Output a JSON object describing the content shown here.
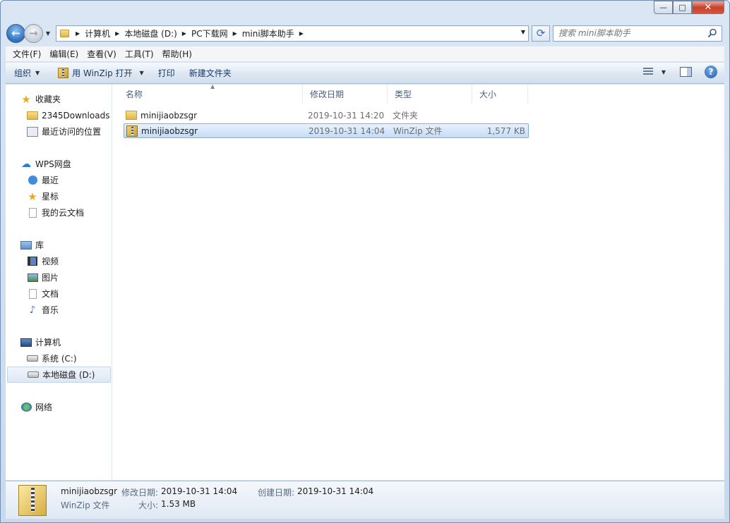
{
  "window": {
    "minimize": "—",
    "maximize": "□",
    "close": "✕"
  },
  "nav": {
    "back_glyph": "←",
    "forward_glyph": "→",
    "breadcrumbs": [
      "计算机",
      "本地磁盘 (D:)",
      "PC下载网",
      "mini脚本助手"
    ],
    "search_placeholder": "搜索 mini脚本助手"
  },
  "menubar": [
    "文件(F)",
    "编辑(E)",
    "查看(V)",
    "工具(T)",
    "帮助(H)"
  ],
  "toolbar": {
    "organize": "组织",
    "open_with": "用 WinZip 打开",
    "print": "打印",
    "new_folder": "新建文件夹",
    "help": "?"
  },
  "sidebar": {
    "favorites": {
      "title": "收藏夹",
      "items": [
        "2345Downloads",
        "最近访问的位置"
      ]
    },
    "wps": {
      "title": "WPS网盘",
      "items": [
        "最近",
        "星标",
        "我的云文档"
      ]
    },
    "libraries": {
      "title": "库",
      "items": [
        "视频",
        "图片",
        "文档",
        "音乐"
      ]
    },
    "computer": {
      "title": "计算机",
      "items": [
        "系统 (C:)",
        "本地磁盘 (D:)"
      ]
    },
    "network": {
      "title": "网络"
    }
  },
  "columns": {
    "name": "名称",
    "date": "修改日期",
    "type": "类型",
    "size": "大小"
  },
  "files": [
    {
      "name": "minijiaobzsgr",
      "date": "2019-10-31 14:20",
      "type": "文件夹",
      "size": "",
      "icon": "folder-icon",
      "selected": false
    },
    {
      "name": "minijiaobzsgr",
      "date": "2019-10-31 14:04",
      "type": "WinZip 文件",
      "size": "1,577 KB",
      "icon": "winzip-file-icon",
      "selected": true
    }
  ],
  "details": {
    "name": "minijiaobzsgr",
    "modified_label": "修改日期:",
    "modified": "2019-10-31 14:04",
    "created_label": "创建日期:",
    "created": "2019-10-31 14:04",
    "type": "WinZip 文件",
    "size_label": "大小:",
    "size": "1.53 MB"
  }
}
